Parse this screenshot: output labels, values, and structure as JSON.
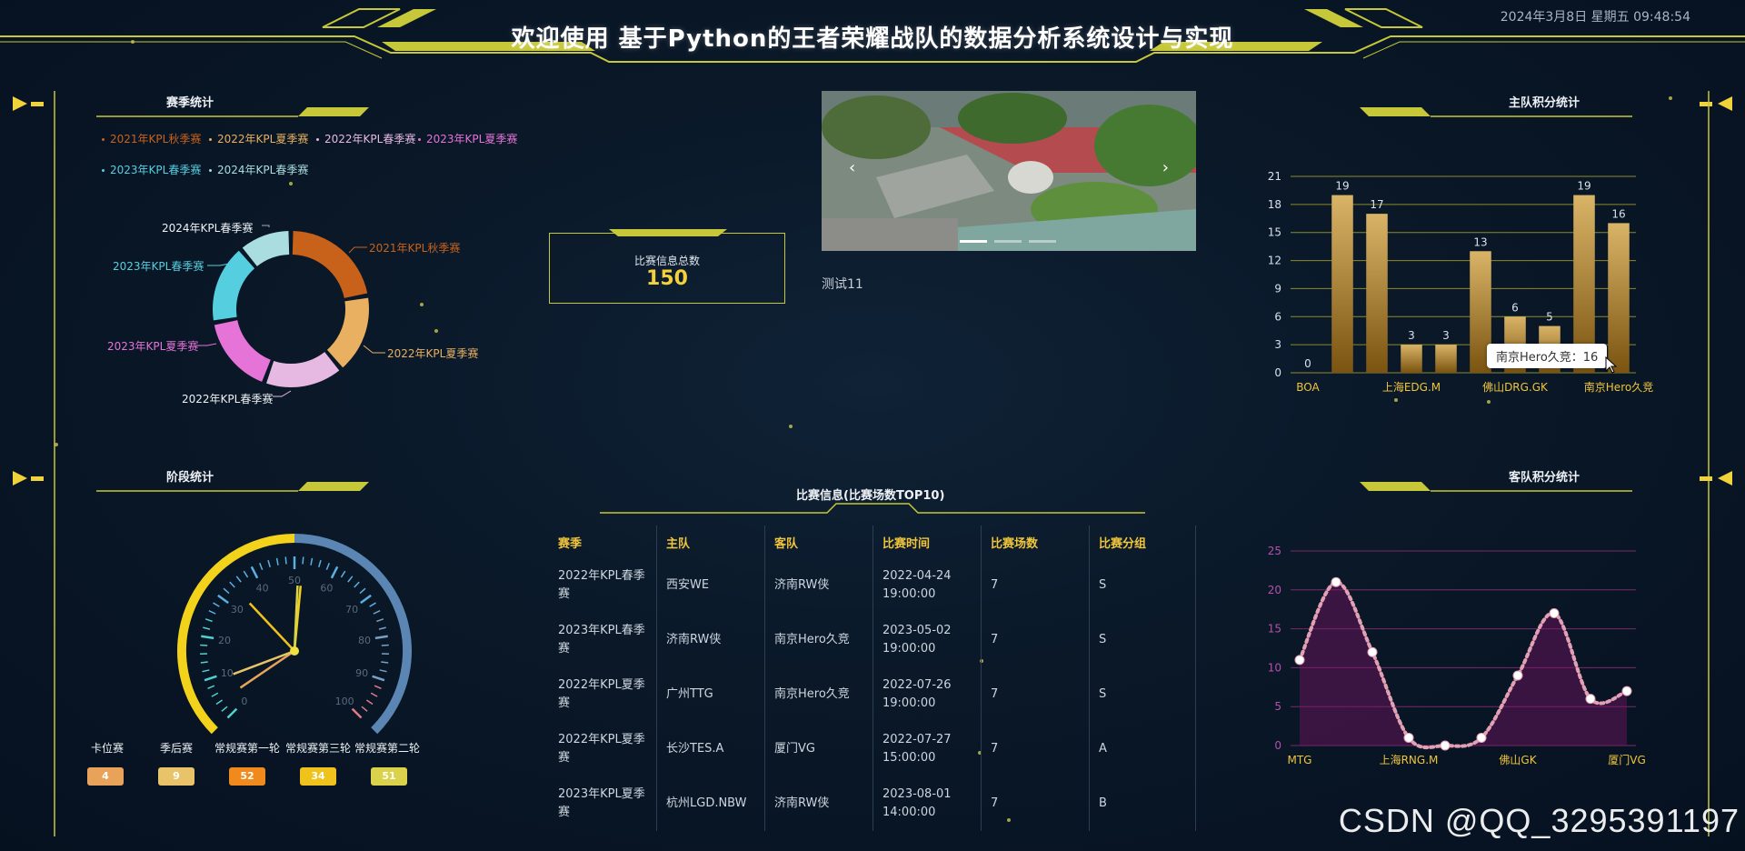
{
  "header": {
    "title": "欢迎使用 基于Python的王者荣耀战队的数据分析系统设计与实现",
    "datetime": "2024年3月8日 星期五 09:48:54"
  },
  "season_panel": {
    "title": "赛季统计",
    "legend": [
      {
        "label": "2021年KPL秋季赛",
        "color": "#c8621a"
      },
      {
        "label": "2022年KPL夏季赛",
        "color": "#e8b060"
      },
      {
        "label": "2022年KPL春季赛",
        "color": "#e6b9e3"
      },
      {
        "label": "2023年KPL夏季赛",
        "color": "#e673d8"
      },
      {
        "label": "2023年KPL春季赛",
        "color": "#55cfdf"
      },
      {
        "label": "2024年KPL春季赛",
        "color": "#a9dde0"
      }
    ],
    "donut_values": [
      4,
      3,
      3,
      3,
      3,
      2
    ]
  },
  "total": {
    "label": "比赛信息总数",
    "value": "150"
  },
  "carousel": {
    "caption": "测试11",
    "prev_icon": "‹",
    "next_icon": "›"
  },
  "home_panel": {
    "title": "主队积分统计",
    "tooltip": "南京Hero久竞：16"
  },
  "stage_panel": {
    "title": "阶段统计",
    "gauge_ticks": [
      "0",
      "10",
      "20",
      "30",
      "40",
      "50",
      "60",
      "70",
      "80",
      "90",
      "100"
    ],
    "items": [
      {
        "label": "卡位赛",
        "value": "4",
        "color": "#e8a25a"
      },
      {
        "label": "季后赛",
        "value": "9",
        "color": "#e8c36a"
      },
      {
        "label": "常规赛第一轮",
        "value": "52",
        "color": "#f08a1c"
      },
      {
        "label": "常规赛第三轮",
        "value": "34",
        "color": "#f0c21c"
      },
      {
        "label": "常规赛第二轮",
        "value": "51",
        "color": "#d9d24a"
      }
    ]
  },
  "table_panel": {
    "title": "比赛信息(比赛场数TOP10)",
    "headers": [
      "赛季",
      "主队",
      "客队",
      "比赛时间",
      "比赛场数",
      "比赛分组"
    ],
    "rows": [
      [
        "2022年KPL春季赛",
        "西安WE",
        "济南RW侠",
        "2022-04-24 19:00:00",
        "7",
        "S"
      ],
      [
        "2023年KPL春季赛",
        "济南RW侠",
        "南京Hero久竞",
        "2023-05-02 19:00:00",
        "7",
        "S"
      ],
      [
        "2022年KPL夏季赛",
        "广州TTG",
        "南京Hero久竞",
        "2022-07-26 19:00:00",
        "7",
        "S"
      ],
      [
        "2022年KPL夏季赛",
        "长沙TES.A",
        "厦门VG",
        "2022-07-27 15:00:00",
        "7",
        "A"
      ],
      [
        "2023年KPL夏季赛",
        "杭州LGD.NBW",
        "济南RW侠",
        "2023-08-01 14:00:00",
        "7",
        "B"
      ]
    ]
  },
  "away_panel": {
    "title": "客队积分统计"
  },
  "chart_data": [
    {
      "type": "bar",
      "title": "主队积分统计",
      "categories": [
        "BOA",
        "",
        "",
        "上海EDG.M",
        "",
        "",
        "佛山DRG.GK",
        "",
        "",
        "南京Hero久竞"
      ],
      "values": [
        0,
        19,
        17,
        3,
        3,
        13,
        6,
        5,
        19,
        16
      ],
      "ylim": [
        0,
        21
      ],
      "yticks": [
        "0",
        "3",
        "6",
        "9",
        "12",
        "15",
        "18",
        "21"
      ],
      "xticklabels": [
        "BOA",
        "上海EDG.M",
        "佛山DRG.GK",
        "南京Hero久竞"
      ],
      "grid": true
    },
    {
      "type": "area",
      "title": "客队积分统计",
      "x": [
        "MTG",
        "",
        "",
        "上海RNG.M",
        "",
        "",
        "佛山GK",
        "",
        "",
        "厦门VG"
      ],
      "values": [
        11,
        21,
        12,
        1,
        0,
        1,
        9,
        17,
        6,
        7
      ],
      "ylim": [
        0,
        25
      ],
      "yticks": [
        "0",
        "5",
        "10",
        "15",
        "20",
        "25"
      ],
      "xticklabels": [
        "MTG",
        "上海RNG.M",
        "佛山GK",
        "厦门VG"
      ],
      "grid": true
    }
  ],
  "watermark": "CSDN @QQ_3295391197"
}
